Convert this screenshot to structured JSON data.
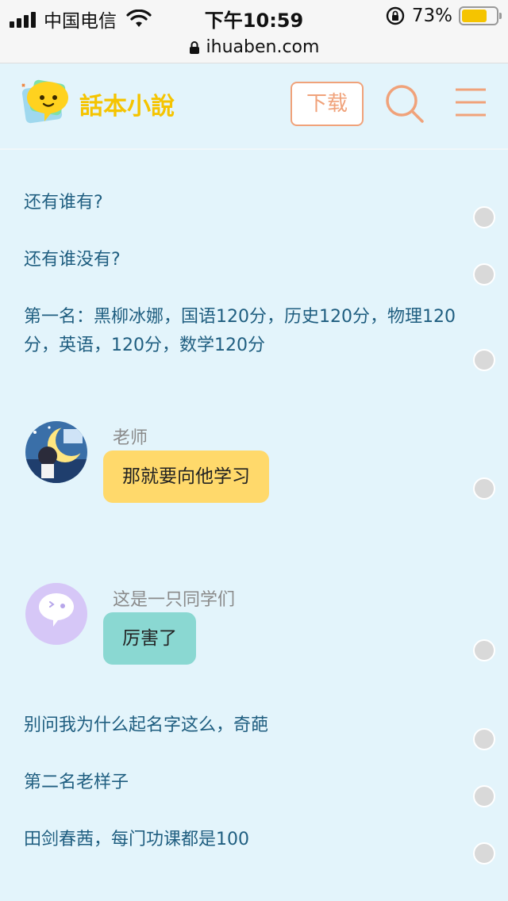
{
  "status_bar": {
    "carrier": "中国电信",
    "time": "下午10:59",
    "battery_percent": "73%",
    "battery_level": 0.73
  },
  "browser": {
    "url": "ihuaben.com"
  },
  "header": {
    "logo_text": "話本小說",
    "download_label": "下载",
    "accent_color": "#f0a27a"
  },
  "story": {
    "lines_top": [
      "还有谁有?",
      "还有谁没有?",
      "第一名：黑柳冰娜，国语120分，历史120分，物理120分，英语，120分，数学120分"
    ],
    "dialogues": [
      {
        "speaker": "老师",
        "text": "那就要向他学习",
        "color": "yellow"
      },
      {
        "speaker": "这是一只同学们",
        "text": "厉害了",
        "color": "teal"
      }
    ],
    "lines_bottom": [
      "别问我为什么起名字这么，奇葩",
      "第二名老样子",
      "田剑春茜，每门功课都是100"
    ]
  }
}
